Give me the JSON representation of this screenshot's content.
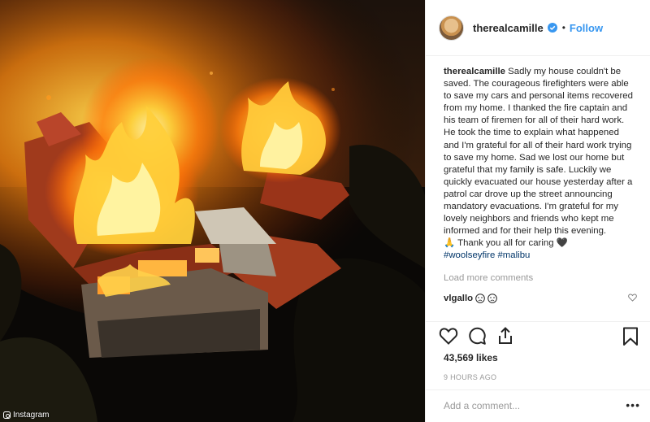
{
  "photo": {
    "credit": "Instagram",
    "icon": "instagram-camera-icon"
  },
  "header": {
    "username": "therealcamille",
    "follow_label": "Follow",
    "separator": "•",
    "verified_icon": "verified-badge-icon"
  },
  "caption": {
    "username": "therealcamille",
    "text": "Sadly my house couldn't be saved. The courageous firefighters were able to save my cars and personal items recovered from my home. I thanked the fire captain and his team of firemen for all of their hard work. He took the time to explain what happened and I'm grateful for all of their hard work trying to save my home. Sad we lost our home but grateful that my family is safe. Luckily we quickly evacuated our house yesterday after a patrol car drove up the street announcing mandatory evacuations. I'm grateful for my lovely neighbors and friends who kept me informed and for their help this evening.",
    "thanks": "🙏 Thank you all for caring 🖤",
    "hashtags": "#woolseyfire #malibu"
  },
  "load_more": "Load more comments",
  "comments": [
    {
      "username": "vlgallo",
      "emojis": [
        "crying-face-icon",
        "crying-face-icon"
      ]
    }
  ],
  "likes": "43,569 likes",
  "timestamp": "9 HOURS AGO",
  "add_comment_placeholder": "Add a comment...",
  "more_label": "•••",
  "colors": {
    "link": "#3897f0",
    "hashtag": "#003569",
    "muted": "#999999",
    "text": "#262626"
  }
}
